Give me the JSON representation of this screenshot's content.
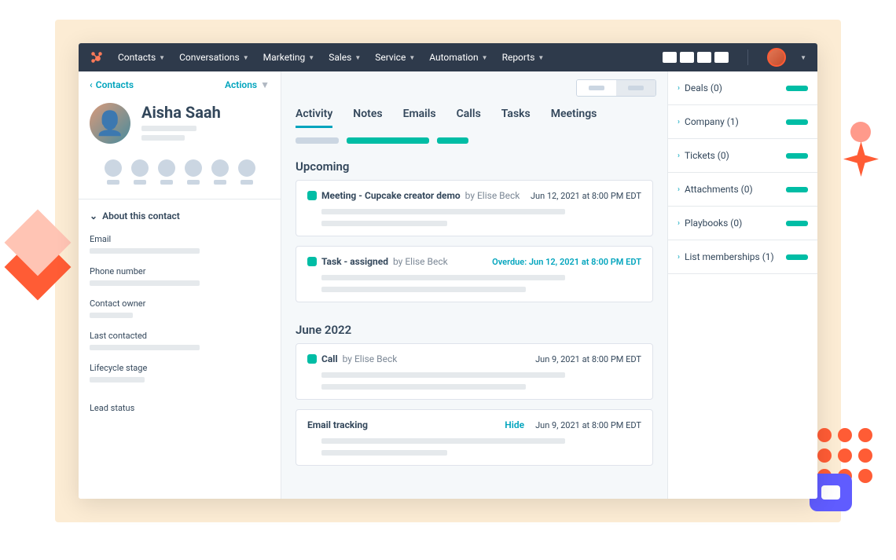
{
  "nav": {
    "items": [
      "Contacts",
      "Conversations",
      "Marketing",
      "Sales",
      "Service",
      "Automation",
      "Reports"
    ]
  },
  "sidebar": {
    "back_label": "Contacts",
    "actions_label": "Actions",
    "contact_name": "Aisha Saah",
    "about_label": "About this contact",
    "fields": [
      {
        "label": "Email"
      },
      {
        "label": "Phone number"
      },
      {
        "label": "Contact owner"
      },
      {
        "label": "Last contacted"
      },
      {
        "label": "Lifecycle stage"
      },
      {
        "label": "Lead status"
      }
    ]
  },
  "main": {
    "tabs": [
      "Activity",
      "Notes",
      "Emails",
      "Calls",
      "Tasks",
      "Meetings"
    ],
    "active_tab": 0,
    "sections": {
      "upcoming": {
        "title": "Upcoming",
        "items": [
          {
            "badge": true,
            "title": "Meeting - Cupcake creator demo",
            "by": "by Elise Beck",
            "date": "Jun 12, 2021 at 8:00 PM EDT",
            "overdue": false,
            "hide": false
          },
          {
            "badge": true,
            "title": "Task - assigned",
            "by": "by Elise Beck",
            "date": "Overdue: Jun 12, 2021 at 8:00 PM EDT",
            "overdue": true,
            "hide": false
          }
        ]
      },
      "june": {
        "title": "June 2022",
        "items": [
          {
            "badge": true,
            "title": "Call",
            "by": "by Elise Beck",
            "date": "Jun 9, 2021 at 8:00 PM EDT",
            "overdue": false,
            "hide": false
          },
          {
            "badge": false,
            "title": "Email tracking",
            "by": "",
            "date": "Jun 9, 2021 at 8:00 PM EDT",
            "overdue": false,
            "hide": true,
            "hide_label": "Hide"
          }
        ]
      }
    }
  },
  "right": {
    "panels": [
      {
        "label": "Deals (0)"
      },
      {
        "label": "Company (1)"
      },
      {
        "label": "Tickets (0)"
      },
      {
        "label": "Attachments (0)"
      },
      {
        "label": "Playbooks (0)"
      },
      {
        "label": "List memberships (1)"
      }
    ]
  }
}
